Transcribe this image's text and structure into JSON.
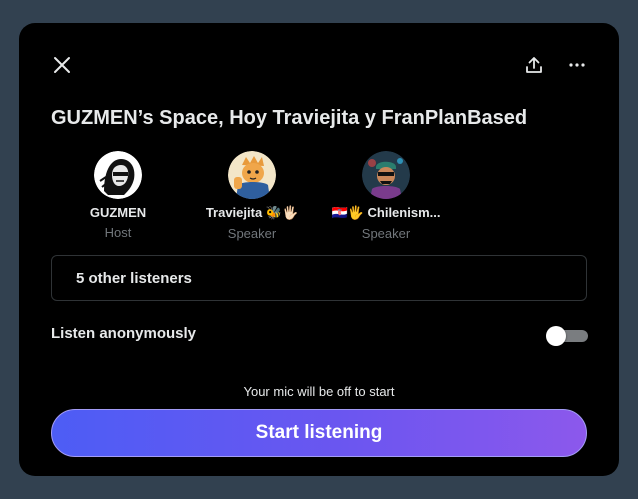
{
  "header": {
    "close_icon": "close-icon",
    "share_icon": "share-icon",
    "more_icon": "more-icon"
  },
  "space": {
    "title": "GUZMEN’s Space, Hoy Traviejita y FranPlanBased"
  },
  "participants": [
    {
      "name": "GUZMEN",
      "role": "Host",
      "avatar_bg": "#ffffff"
    },
    {
      "name": "Traviejita 🐝🖐🏻",
      "role": "Speaker",
      "avatar_bg": "#f3e6c8"
    },
    {
      "name": "🇭🇷🖐 Chilenism...",
      "role": "Speaker",
      "avatar_bg": "#233a4a"
    }
  ],
  "listeners": {
    "label": "5 other listeners"
  },
  "anonymous": {
    "label": "Listen anonymously",
    "enabled": false
  },
  "footer": {
    "mic_note": "Your mic will be off to start",
    "start_label": "Start listening"
  },
  "colors": {
    "background": "#324150",
    "modal": "#000000",
    "text": "#e7e9ea",
    "muted": "#71767b",
    "button_gradient_start": "#4d5df5",
    "button_gradient_end": "#8c58ec"
  }
}
